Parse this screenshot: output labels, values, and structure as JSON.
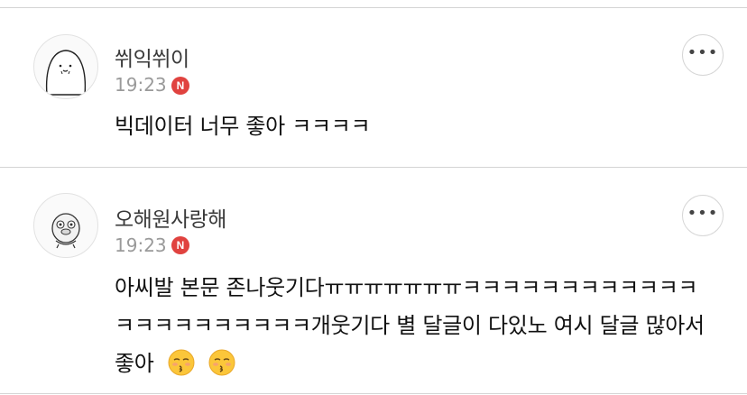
{
  "comments": [
    {
      "username": "쒸익쒸이",
      "time": "19:23",
      "badge": "N",
      "text": "빅데이터 너무 좋아 ㅋㅋㅋㅋ",
      "more_label": "•••"
    },
    {
      "username": "오해원사랑해",
      "time": "19:23",
      "badge": "N",
      "text": "아씨발 본문 존나웃기다ㅠㅠㅠㅠㅠㅠㅠㅋㅋㅋㅋㅋㅋㅋㅋㅋㅋㅋㅋㅋㅋㅋㅋㅋㅋㅋㅋㅋㅋ개웃기다 별 달글이 다있노 여시 달글 많아서 좋아",
      "emojis": [
        "kissing-closed-eyes-face",
        "kissing-closed-eyes-face"
      ],
      "more_label": "•••"
    }
  ],
  "colors": {
    "badge": "#e0423f",
    "divider": "#d4d4d4",
    "meta_text": "#9a9a9a"
  }
}
